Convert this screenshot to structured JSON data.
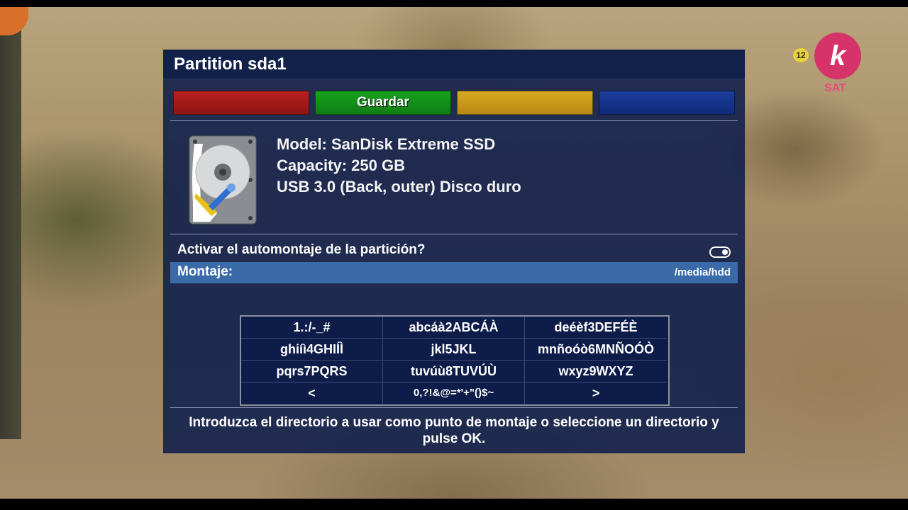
{
  "background": {
    "channel_logo_glyph": "k",
    "channel_sub": "SAT",
    "age_rating": "12"
  },
  "dialog": {
    "title": "Partition sda1",
    "buttons": {
      "red": "",
      "green": "Guardar",
      "yellow": "",
      "blue": ""
    },
    "device": {
      "icon": "hard-disk-icon",
      "model": "Model: SanDisk Extreme SSD",
      "capacity": "Capacity: 250 GB",
      "connection": "USB 3.0 (Back, outer) Disco duro"
    },
    "settings": {
      "automount_label": "Activar el automontaje de la partición?",
      "automount_enabled": true,
      "mount_label": "Montaje:",
      "mount_value": "/media/hdd"
    },
    "keyboard": {
      "keys": [
        [
          "1.:/-_#",
          "abcáà2ABCÁÀ",
          "deéèf3DEFÉÈ"
        ],
        [
          "ghiíì4GHIÍÌ",
          "jkl5JKL",
          "mnñoóò6MNÑOÓÒ"
        ],
        [
          "pqrs7PQRS",
          "tuvúù8TUVÚÙ",
          "wxyz9WXYZ"
        ],
        [
          "<",
          "0,?!&@=*'+\"()$~",
          ">"
        ]
      ]
    },
    "help_text": "Introduzca el directorio a usar como punto de montaje o seleccione un directorio y pulse OK."
  },
  "colors": {
    "dialog_bg": "#16244e",
    "highlight": "#3a6aa8",
    "red": "#b82020",
    "green": "#17a21c",
    "yellow": "#d6aa22",
    "blue": "#1a3d9c"
  }
}
